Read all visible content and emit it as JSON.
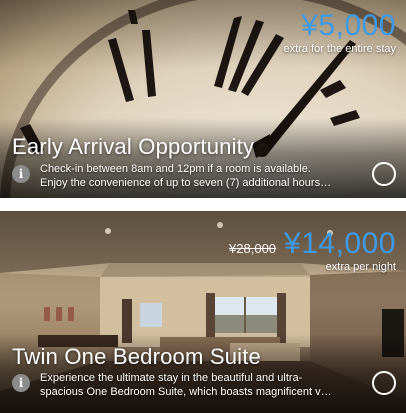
{
  "offers": [
    {
      "price": "¥5,000",
      "price_note": "extra for the entire stay",
      "title": "Early Arrival Opportunity",
      "desc_line1": "Check-in between 8am and 12pm if a room is available.",
      "desc_line2": "Enjoy the convenience of up to seven (7) additional hours…"
    },
    {
      "price_old": "¥28,000",
      "price": "¥14,000",
      "price_note": "extra per night",
      "title": "Twin One Bedroom Suite",
      "desc_line1": "Experience the ultimate stay in the beautiful and ultra-",
      "desc_line2": "spacious One Bedroom Suite, which boasts magnificent v…"
    }
  ],
  "colors": {
    "price_accent": "#3f9ae6"
  },
  "icons": {
    "info": "info-icon",
    "select": "selection-radio-icon"
  }
}
